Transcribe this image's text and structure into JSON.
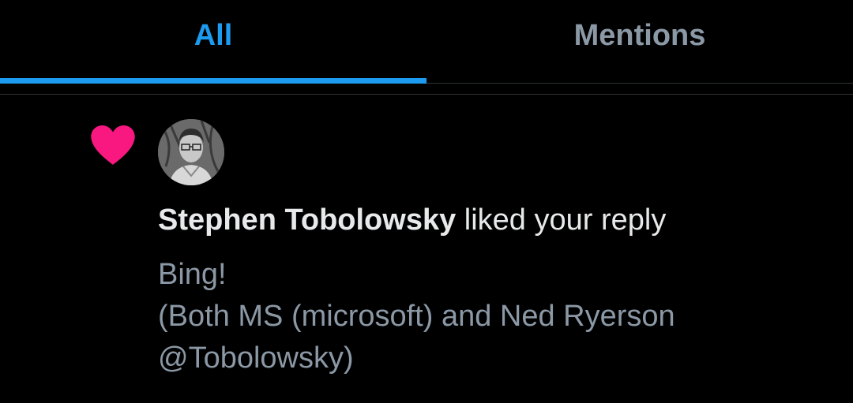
{
  "tabs": [
    {
      "label": "All",
      "active": true
    },
    {
      "label": "Mentions",
      "active": false
    }
  ],
  "colors": {
    "accent": "#1d9bf0",
    "heart": "#f91880",
    "muted_text": "#8b98a5",
    "primary_text": "#e7e9ea"
  },
  "notification": {
    "icon": "heart-icon",
    "user_name": "Stephen Tobolowsky",
    "action": " liked your reply",
    "body_lines": [
      "Bing!",
      "(Both MS (microsoft) and Ned Ryerson",
      "@Tobolowsky)"
    ]
  }
}
